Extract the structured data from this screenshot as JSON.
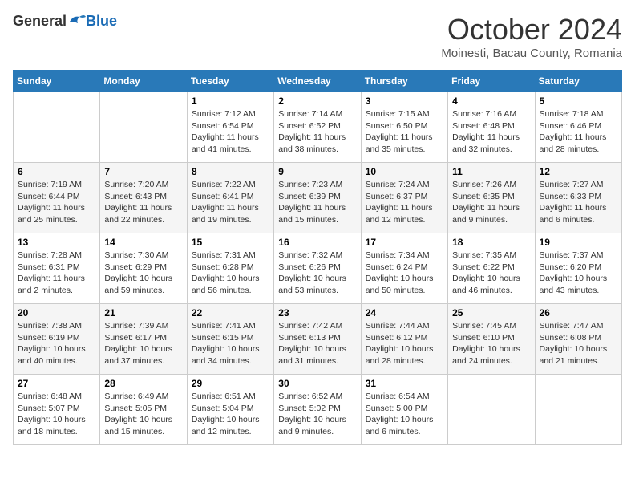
{
  "logo": {
    "general": "General",
    "blue": "Blue"
  },
  "title": "October 2024",
  "subtitle": "Moinesti, Bacau County, Romania",
  "days_of_week": [
    "Sunday",
    "Monday",
    "Tuesday",
    "Wednesday",
    "Thursday",
    "Friday",
    "Saturday"
  ],
  "weeks": [
    [
      {
        "day": "",
        "info": ""
      },
      {
        "day": "",
        "info": ""
      },
      {
        "day": "1",
        "info": "Sunrise: 7:12 AM\nSunset: 6:54 PM\nDaylight: 11 hours and 41 minutes."
      },
      {
        "day": "2",
        "info": "Sunrise: 7:14 AM\nSunset: 6:52 PM\nDaylight: 11 hours and 38 minutes."
      },
      {
        "day": "3",
        "info": "Sunrise: 7:15 AM\nSunset: 6:50 PM\nDaylight: 11 hours and 35 minutes."
      },
      {
        "day": "4",
        "info": "Sunrise: 7:16 AM\nSunset: 6:48 PM\nDaylight: 11 hours and 32 minutes."
      },
      {
        "day": "5",
        "info": "Sunrise: 7:18 AM\nSunset: 6:46 PM\nDaylight: 11 hours and 28 minutes."
      }
    ],
    [
      {
        "day": "6",
        "info": "Sunrise: 7:19 AM\nSunset: 6:44 PM\nDaylight: 11 hours and 25 minutes."
      },
      {
        "day": "7",
        "info": "Sunrise: 7:20 AM\nSunset: 6:43 PM\nDaylight: 11 hours and 22 minutes."
      },
      {
        "day": "8",
        "info": "Sunrise: 7:22 AM\nSunset: 6:41 PM\nDaylight: 11 hours and 19 minutes."
      },
      {
        "day": "9",
        "info": "Sunrise: 7:23 AM\nSunset: 6:39 PM\nDaylight: 11 hours and 15 minutes."
      },
      {
        "day": "10",
        "info": "Sunrise: 7:24 AM\nSunset: 6:37 PM\nDaylight: 11 hours and 12 minutes."
      },
      {
        "day": "11",
        "info": "Sunrise: 7:26 AM\nSunset: 6:35 PM\nDaylight: 11 hours and 9 minutes."
      },
      {
        "day": "12",
        "info": "Sunrise: 7:27 AM\nSunset: 6:33 PM\nDaylight: 11 hours and 6 minutes."
      }
    ],
    [
      {
        "day": "13",
        "info": "Sunrise: 7:28 AM\nSunset: 6:31 PM\nDaylight: 11 hours and 2 minutes."
      },
      {
        "day": "14",
        "info": "Sunrise: 7:30 AM\nSunset: 6:29 PM\nDaylight: 10 hours and 59 minutes."
      },
      {
        "day": "15",
        "info": "Sunrise: 7:31 AM\nSunset: 6:28 PM\nDaylight: 10 hours and 56 minutes."
      },
      {
        "day": "16",
        "info": "Sunrise: 7:32 AM\nSunset: 6:26 PM\nDaylight: 10 hours and 53 minutes."
      },
      {
        "day": "17",
        "info": "Sunrise: 7:34 AM\nSunset: 6:24 PM\nDaylight: 10 hours and 50 minutes."
      },
      {
        "day": "18",
        "info": "Sunrise: 7:35 AM\nSunset: 6:22 PM\nDaylight: 10 hours and 46 minutes."
      },
      {
        "day": "19",
        "info": "Sunrise: 7:37 AM\nSunset: 6:20 PM\nDaylight: 10 hours and 43 minutes."
      }
    ],
    [
      {
        "day": "20",
        "info": "Sunrise: 7:38 AM\nSunset: 6:19 PM\nDaylight: 10 hours and 40 minutes."
      },
      {
        "day": "21",
        "info": "Sunrise: 7:39 AM\nSunset: 6:17 PM\nDaylight: 10 hours and 37 minutes."
      },
      {
        "day": "22",
        "info": "Sunrise: 7:41 AM\nSunset: 6:15 PM\nDaylight: 10 hours and 34 minutes."
      },
      {
        "day": "23",
        "info": "Sunrise: 7:42 AM\nSunset: 6:13 PM\nDaylight: 10 hours and 31 minutes."
      },
      {
        "day": "24",
        "info": "Sunrise: 7:44 AM\nSunset: 6:12 PM\nDaylight: 10 hours and 28 minutes."
      },
      {
        "day": "25",
        "info": "Sunrise: 7:45 AM\nSunset: 6:10 PM\nDaylight: 10 hours and 24 minutes."
      },
      {
        "day": "26",
        "info": "Sunrise: 7:47 AM\nSunset: 6:08 PM\nDaylight: 10 hours and 21 minutes."
      }
    ],
    [
      {
        "day": "27",
        "info": "Sunrise: 6:48 AM\nSunset: 5:07 PM\nDaylight: 10 hours and 18 minutes."
      },
      {
        "day": "28",
        "info": "Sunrise: 6:49 AM\nSunset: 5:05 PM\nDaylight: 10 hours and 15 minutes."
      },
      {
        "day": "29",
        "info": "Sunrise: 6:51 AM\nSunset: 5:04 PM\nDaylight: 10 hours and 12 minutes."
      },
      {
        "day": "30",
        "info": "Sunrise: 6:52 AM\nSunset: 5:02 PM\nDaylight: 10 hours and 9 minutes."
      },
      {
        "day": "31",
        "info": "Sunrise: 6:54 AM\nSunset: 5:00 PM\nDaylight: 10 hours and 6 minutes."
      },
      {
        "day": "",
        "info": ""
      },
      {
        "day": "",
        "info": ""
      }
    ]
  ]
}
